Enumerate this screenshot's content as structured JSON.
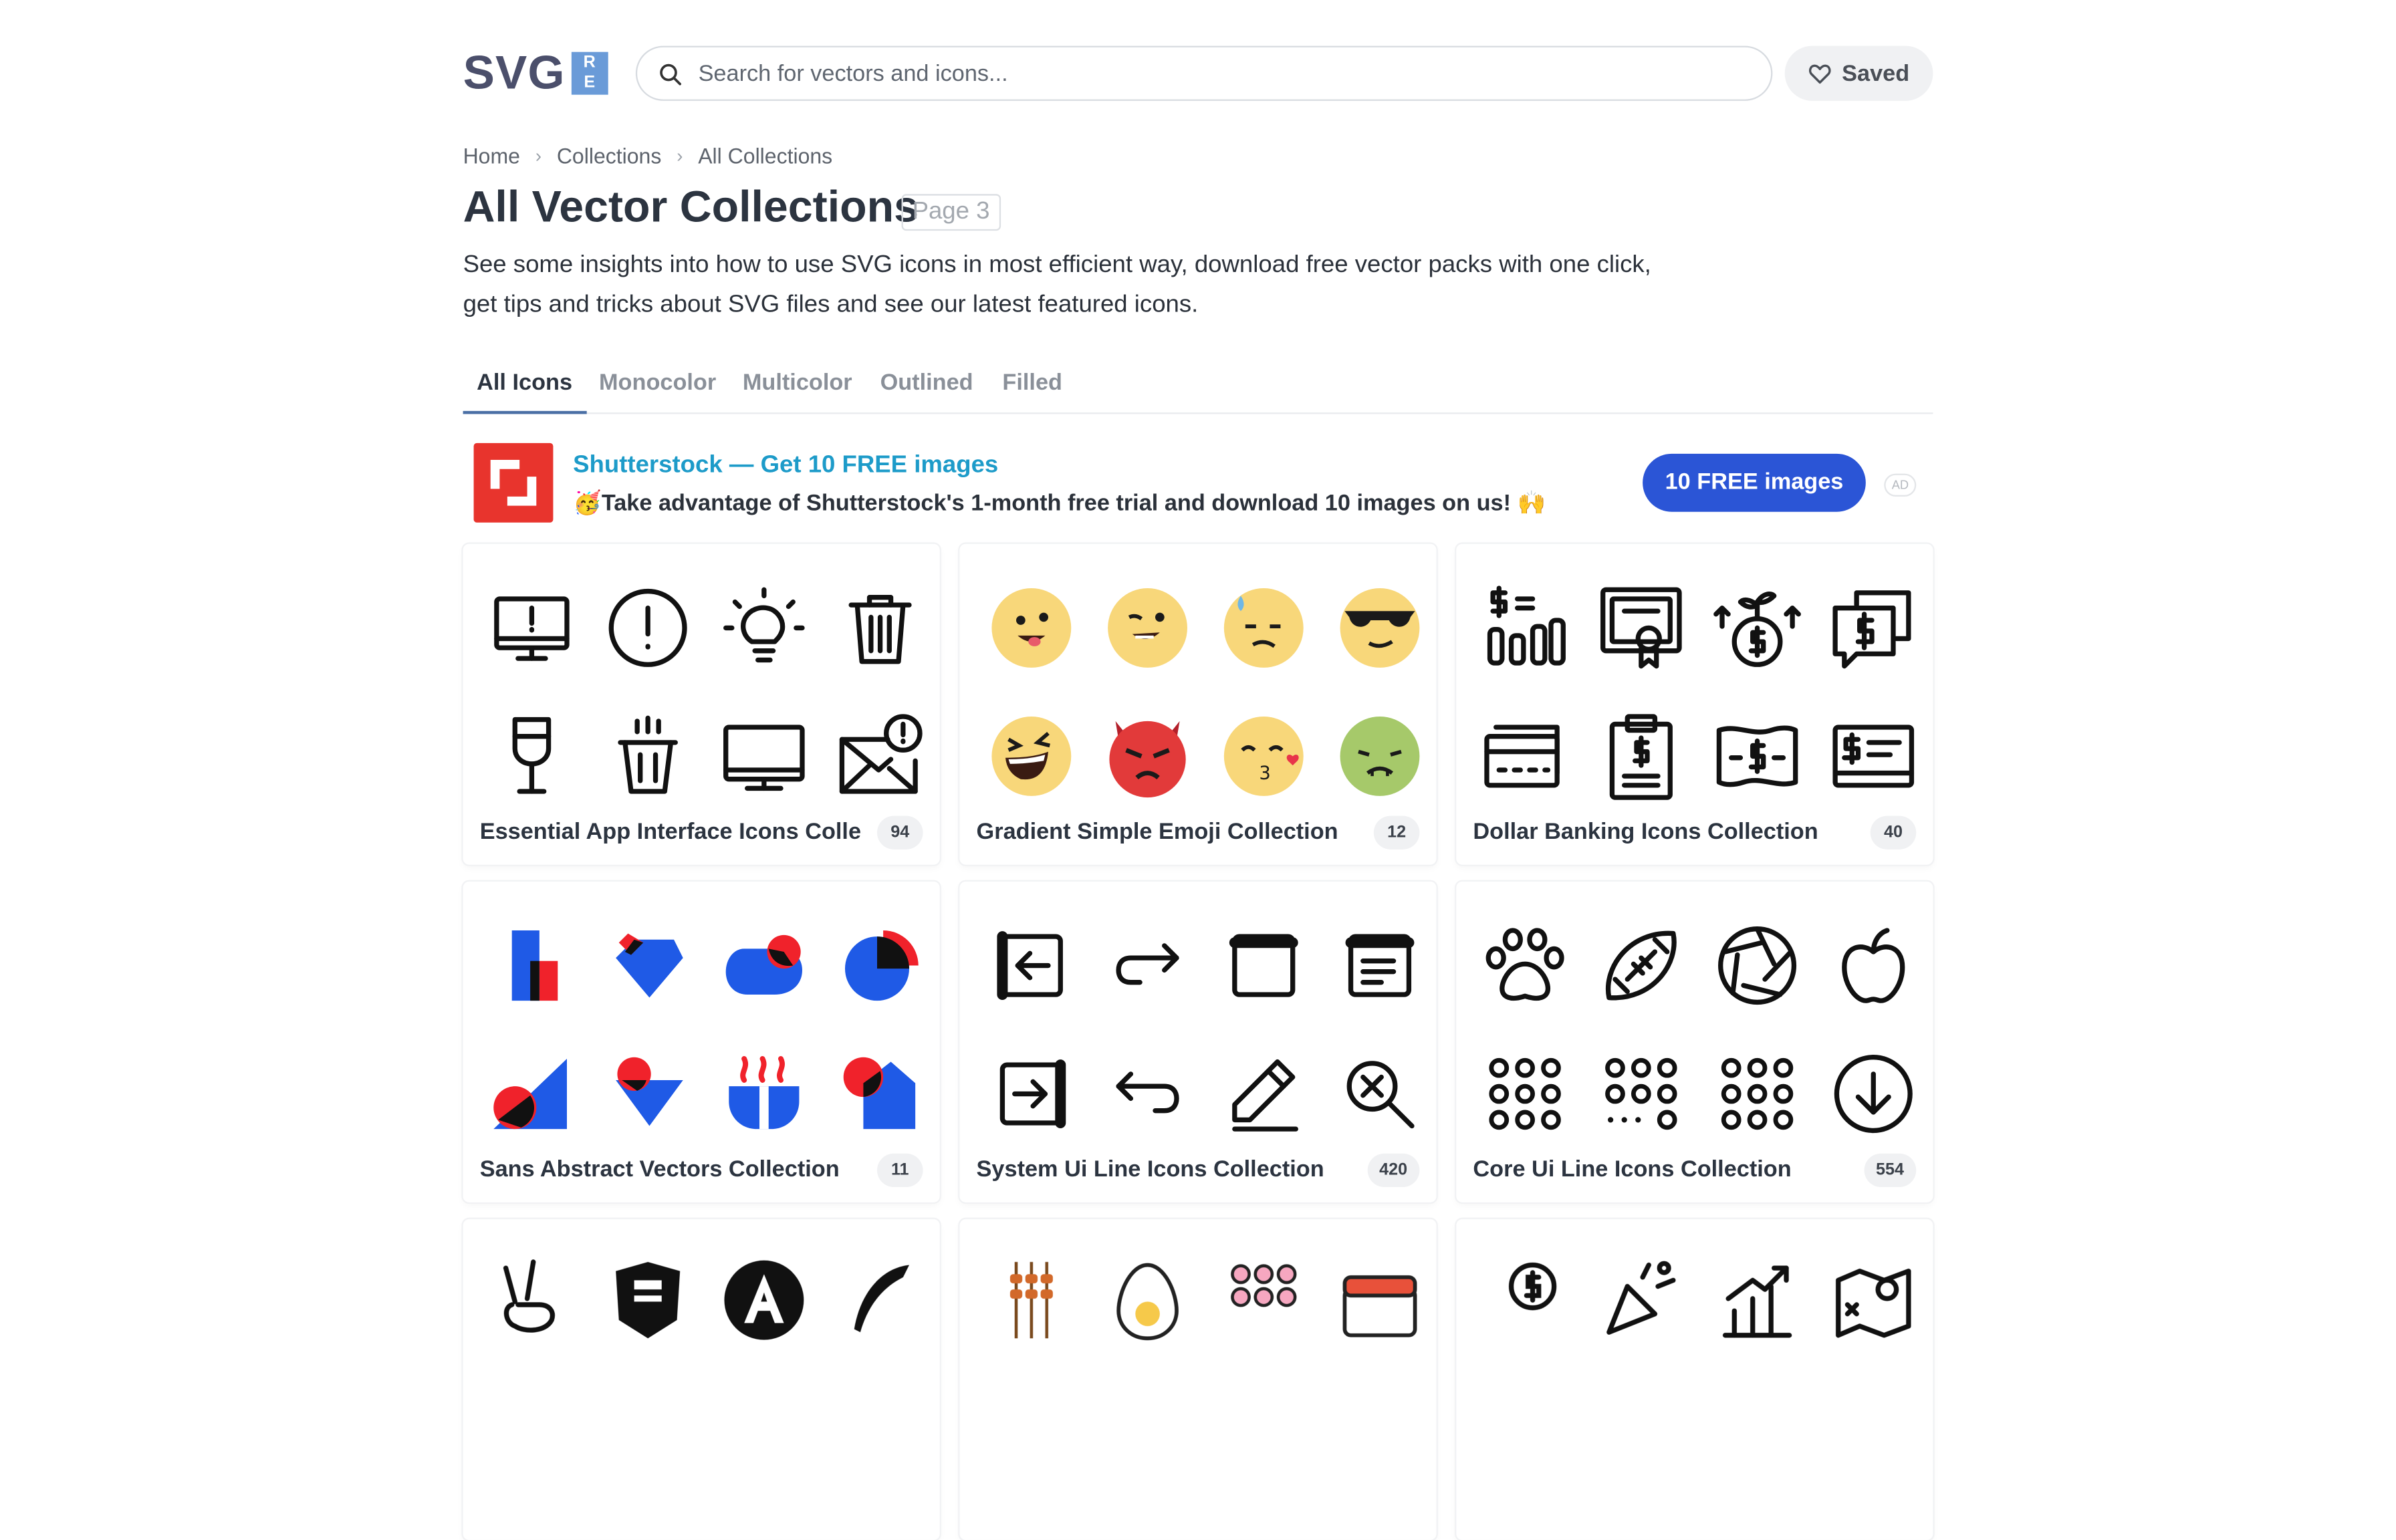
{
  "header": {
    "logo_text": "SVG",
    "logo_badge": "REPO",
    "search_placeholder": "Search for vectors and icons...",
    "saved_label": "Saved"
  },
  "breadcrumb": [
    "Home",
    "Collections",
    "All Collections"
  ],
  "page": {
    "title": "All Vector Collections",
    "badge": "Page 3",
    "intro": "See some insights into how to use SVG icons in most efficient way, download free vector packs with one click, get tips and tricks about SVG files and see our latest featured icons."
  },
  "tabs": [
    "All Icons",
    "Monocolor",
    "Multicolor",
    "Outlined",
    "Filled"
  ],
  "active_tab": "All Icons",
  "ad": {
    "title": "Shutterstock — Get 10 FREE images",
    "subtitle": "🥳Take advantage of Shutterstock's 1-month free trial and download 10 images on us! 🙌",
    "button": "10 FREE images",
    "tag": "AD"
  },
  "collections": [
    {
      "title": "Essential App Interface Icons Collection",
      "count": "94",
      "icons": [
        "monitor-alert-icon",
        "exclamation-circle-icon",
        "lightbulb-icon",
        "trash-icon",
        "wine-glass-icon",
        "trash-bin-icon",
        "desktop-icon",
        "mail-alert-icon"
      ]
    },
    {
      "title": "Gradient Simple Emoji Collection",
      "count": "12",
      "icons": [
        "tongue-emoji-icon",
        "wink-emoji-icon",
        "sweat-emoji-icon",
        "sunglasses-emoji-icon",
        "laughing-emoji-icon",
        "devil-emoji-icon",
        "kiss-emoji-icon",
        "sick-emoji-icon"
      ]
    },
    {
      "title": "Dollar Banking Icons Collection",
      "count": "40",
      "icons": [
        "dollar-chart-icon",
        "certificate-icon",
        "money-plant-icon",
        "dollar-chat-icon",
        "credit-card-icon",
        "dollar-clipboard-icon",
        "banknote-icon",
        "dollar-bill-icon"
      ]
    },
    {
      "title": "Sans Abstract Vectors Collection",
      "count": "11",
      "icons": [
        "abstract-rect-icon",
        "abstract-diamond-icon",
        "abstract-blob-icon",
        "abstract-pie-icon",
        "abstract-triangle-icon",
        "abstract-heart-icon",
        "abstract-bowl-icon",
        "abstract-house-icon"
      ]
    },
    {
      "title": "System Ui Line Icons Collection",
      "count": "420",
      "icons": [
        "arrow-left-box-icon",
        "arrow-redo-icon",
        "window-icon",
        "document-window-icon",
        "arrow-right-box-icon",
        "arrow-undo-icon",
        "pencil-icon",
        "search-x-icon"
      ]
    },
    {
      "title": "Core Ui Line Icons Collection",
      "count": "554",
      "icons": [
        "paw-icon",
        "football-icon",
        "aperture-icon",
        "apple-icon",
        "dots-grid-icon",
        "dots-grid-partial-icon",
        "dots-grid-circle-icon",
        "arrow-down-circle-icon"
      ]
    },
    {
      "title": "",
      "count": "",
      "icons": [
        "peace-hand-icon",
        "form-badge-icon",
        "angular-icon",
        "quill-icon"
      ]
    },
    {
      "title": "",
      "count": "",
      "icons": [
        "kebab-skewers-icon",
        "egg-icon",
        "dots-pink-icon",
        "sushi-icon"
      ]
    },
    {
      "title": "",
      "count": "",
      "icons": [
        "coins-icon",
        "celebrate-icon",
        "growth-chart-icon",
        "map-location-icon"
      ]
    }
  ],
  "colors": {
    "accent": "#2b55d6",
    "link": "#1d9bc9",
    "ad_red": "#e8342d",
    "emoji_yellow": "#f8d77a",
    "emoji_red": "#e23a3a",
    "emoji_green": "#a6c96a",
    "abstract_blue": "#1f5ae6",
    "abstract_red": "#f0222b"
  }
}
